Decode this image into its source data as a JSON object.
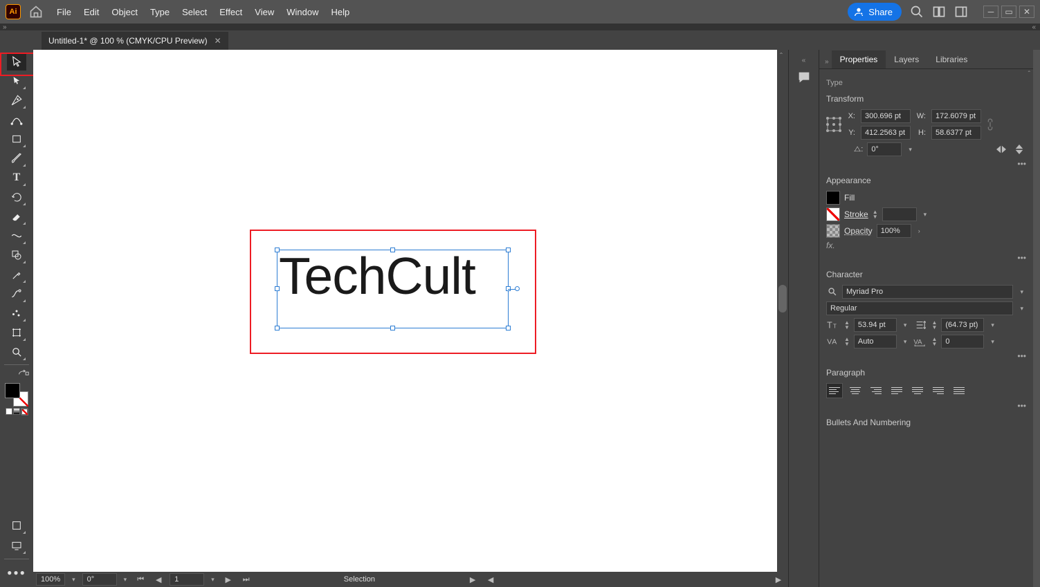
{
  "menubar": {
    "items": [
      "File",
      "Edit",
      "Object",
      "Type",
      "Select",
      "Effect",
      "View",
      "Window",
      "Help"
    ],
    "share_label": "Share"
  },
  "document_tab": "Untitled-1* @ 100 % (CMYK/CPU Preview)",
  "canvas_text": "TechCult",
  "status": {
    "zoom": "100%",
    "rotation": "0°",
    "page": "1",
    "mode": "Selection"
  },
  "panel": {
    "tabs": [
      "Properties",
      "Layers",
      "Libraries"
    ],
    "type_section": "Type",
    "transform": {
      "header": "Transform",
      "x_label": "X:",
      "y_label": "Y:",
      "w_label": "W:",
      "h_label": "H:",
      "x": "300.696 pt",
      "y": "412.2563 pt",
      "w": "172.6079 pt",
      "h": "58.6377 pt",
      "angle_label": "⧍:",
      "angle": "0°"
    },
    "appearance": {
      "header": "Appearance",
      "fill_label": "Fill",
      "stroke_label": "Stroke",
      "opacity_label": "Opacity",
      "opacity_value": "100%",
      "fx_label": "fx."
    },
    "character": {
      "header": "Character",
      "font": "Myriad Pro",
      "style": "Regular",
      "size": "53.94 pt",
      "leading": "(64.73 pt)",
      "kerning": "Auto",
      "tracking": "0"
    },
    "paragraph": {
      "header": "Paragraph"
    },
    "bullets": {
      "header": "Bullets And Numbering"
    }
  }
}
